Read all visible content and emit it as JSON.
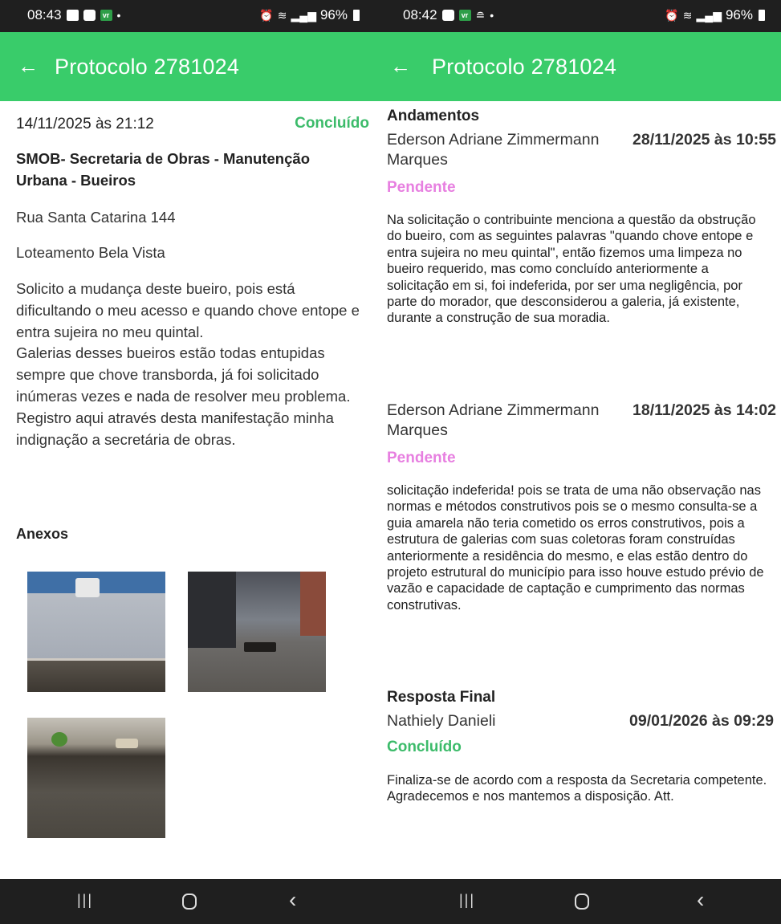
{
  "left_screen": {
    "status_bar": {
      "time": "08:43",
      "battery": "96%"
    },
    "app_bar": {
      "back_icon": "arrow-left-icon",
      "title": "Protocolo 2781024"
    },
    "request": {
      "date": "14/11/2025 às 21:12",
      "status": "Concluído",
      "secretaria": "SMOB- Secretaria de Obras - Manutenção Urbana - Bueiros",
      "address": "Rua Santa Catarina 144",
      "neighborhood": "Loteamento Bela Vista",
      "description": "Solicito a mudança deste bueiro, pois está dificultando o meu acesso e quando chove entope e entra sujeira no meu quintal.\nGalerias desses bueiros estão todas entupidas sempre que chove transborda, já foi solicitado inúmeras vezes e nada de resolver meu problema.\nRegistro aqui através desta manifestação minha indignação a secretária de obras."
    },
    "attachments_title": "Anexos"
  },
  "right_screen": {
    "status_bar": {
      "time": "08:42",
      "battery": "96%"
    },
    "app_bar": {
      "back_icon": "arrow-left-icon",
      "title": "Protocolo 2781024"
    },
    "andamentos_title": "Andamentos",
    "andamentos": [
      {
        "person": "Ederson Adriane Zimmermann Marques",
        "date": "28/11/2025 às 10:55",
        "status": "Pendente",
        "text": "Na solicitação o contribuinte menciona a questão da obstrução do bueiro, com as seguintes palavras \"quando chove entope e entra sujeira no meu quintal\", então fizemos uma limpeza no bueiro requerido, mas como concluído anteriormente a solicitação em si, foi indeferida, por ser uma negligência, por parte do morador, que desconsiderou a galeria, já existente, durante a construção de sua moradia."
      },
      {
        "person": "Ederson Adriane Zimmermann Marques",
        "date": "18/11/2025 às 14:02",
        "status": "Pendente",
        "text": "solicitação indeferida! pois se trata de uma não observação nas normas e métodos construtivos pois se o mesmo consulta-se a guia amarela não teria cometido os erros construtivos, pois a estrutura de galerias com suas coletoras foram construídas anteriormente a residência do mesmo, e elas estão dentro do projeto estrutural do município para isso houve estudo prévio de vazão e capacidade de captação e cumprimento das normas construtivas."
      }
    ],
    "final_title": "Resposta Final",
    "final": {
      "person": "Nathiely Danieli",
      "date": "09/01/2026 às 09:29",
      "status": "Concluído",
      "text": "Finaliza-se de acordo com a resposta da Secretaria competente.\nAgradecemos e nos mantemos a disposição. Att."
    }
  },
  "colors": {
    "app_bar": "#39cc6a",
    "status_done": "#3cbb6a",
    "status_pending": "#e77fe0",
    "system_bars": "#1f1f1f"
  }
}
